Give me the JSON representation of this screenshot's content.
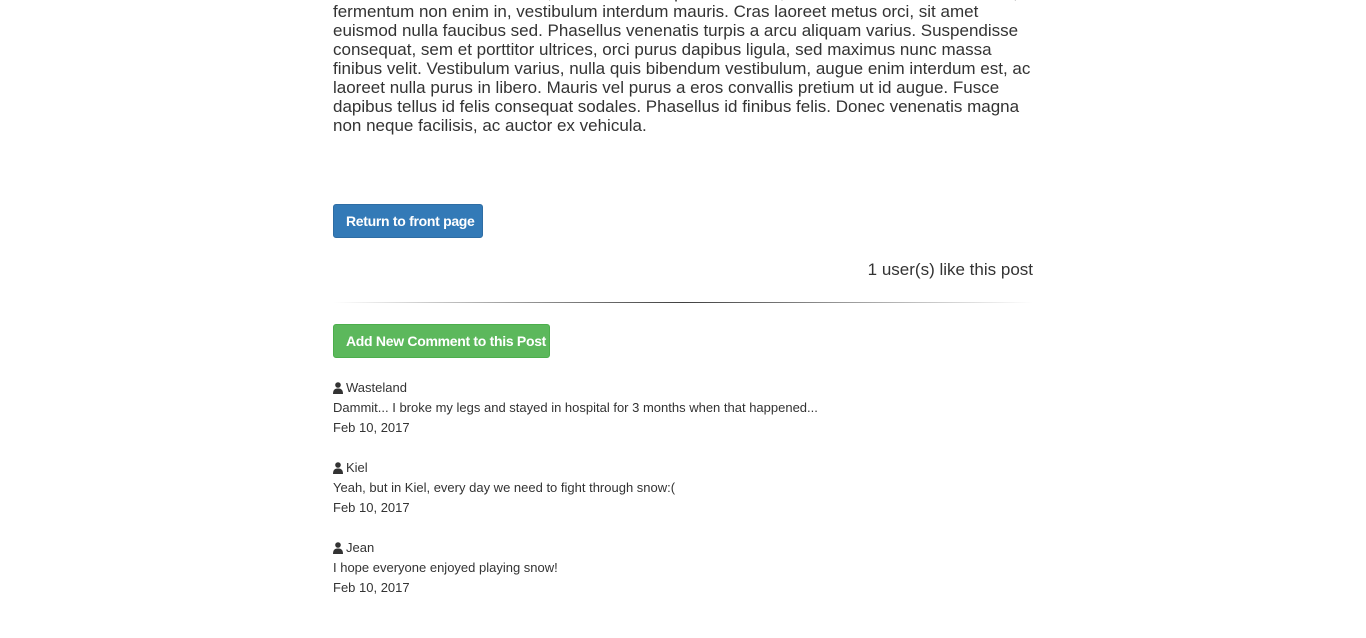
{
  "post": {
    "body": "eu lacus. Nunc libero mauris, lacinia ullamcorper mollis non, dictum et est. Morbi eros ante, fermentum non enim in, vestibulum interdum mauris. Cras laoreet metus orci, sit amet euismod nulla faucibus sed. Phasellus venenatis turpis a arcu aliquam varius. Suspendisse consequat, sem et porttitor ultrices, orci purus dapibus ligula, sed maximus nunc massa finibus velit. Vestibulum varius, nulla quis bibendum vestibulum, augue enim interdum est, ac laoreet nulla purus in libero. Mauris vel purus a eros convallis pretium ut id augue. Fusce dapibus tellus id felis consequat sodales. Phasellus id finibus felis. Donec venenatis magna non neque facilisis, ac auctor ex vehicula.",
    "return_label": "Return to front page",
    "likes_text": "1 user(s) like this post"
  },
  "comments_section": {
    "add_comment_label": "Add New Comment to this Post",
    "items": [
      {
        "author": "Wasteland",
        "text": "Dammit... I broke my legs and stayed in hospital for 3 months when that happened...",
        "date": "Feb 10, 2017"
      },
      {
        "author": "Kiel",
        "text": "Yeah, but in Kiel, every day we need to fight through snow:(",
        "date": "Feb 10, 2017"
      },
      {
        "author": "Jean",
        "text": "I hope everyone enjoyed playing snow!",
        "date": "Feb 10, 2017"
      }
    ]
  },
  "icons": {
    "comment_author": "user-icon"
  },
  "colors": {
    "primary": "#337ab7",
    "success": "#5cb85c",
    "text": "#333333"
  }
}
